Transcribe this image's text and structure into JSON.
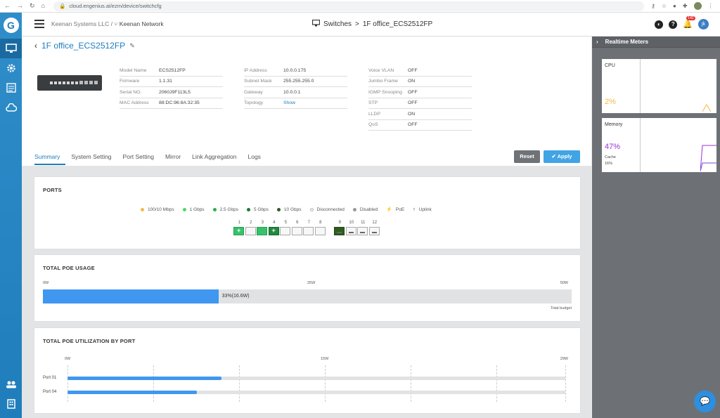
{
  "browser": {
    "url": "cloud.engenius.ai/ezm/device/switchcfg"
  },
  "header": {
    "org": "Keenan Systems LLC /",
    "network": "Keenan Network",
    "crumb_root": "Switches",
    "crumb_sep": ">",
    "crumb_leaf": "1F office_ECS2512FP",
    "notif_count": "142",
    "avatar_initials": "jk"
  },
  "device": {
    "title": "1F office_ECS2512FP",
    "col1": [
      {
        "k": "Model Name",
        "v": "ECS2512FP"
      },
      {
        "k": "Firmware",
        "v": "1.1.31"
      },
      {
        "k": "Serial NO.",
        "v": "2060J9F113L5"
      },
      {
        "k": "MAC Address",
        "v": "88:DC:96:8A:32:35"
      }
    ],
    "col2": [
      {
        "k": "IP Address",
        "v": "10.0.0.175"
      },
      {
        "k": "Subnet Mask",
        "v": "255.255.255.0"
      },
      {
        "k": "Gateway",
        "v": "10.0.0.1"
      },
      {
        "k": "Topology",
        "v": "Show"
      }
    ],
    "col3": [
      {
        "k": "Voice VLAN",
        "v": "OFF"
      },
      {
        "k": "Jumbo Frame",
        "v": "ON"
      },
      {
        "k": "IGMP Snooping",
        "v": "OFF"
      },
      {
        "k": "STP",
        "v": "OFF"
      },
      {
        "k": "LLDP",
        "v": "ON"
      },
      {
        "k": "QoS",
        "v": "OFF"
      }
    ]
  },
  "tabs": [
    "Summary",
    "System Setting",
    "Port Setting",
    "Mirror",
    "Link Aggregation",
    "Logs"
  ],
  "buttons": {
    "reset": "Reset",
    "apply": "Apply"
  },
  "ports_card": {
    "title": "PORTS",
    "legend": [
      {
        "label": "100/10 Mbps",
        "color": "#f5b942"
      },
      {
        "label": "1 Gbps",
        "color": "#4cd964"
      },
      {
        "label": "2.5 Gbps",
        "color": "#2ab04c"
      },
      {
        "label": "5 Gbps",
        "color": "#1a7a34"
      },
      {
        "label": "10 Gbps",
        "color": "#2e5d1d"
      },
      {
        "label": "Disconnected",
        "color": "#eeeeee"
      },
      {
        "label": "Disabled",
        "color": "#999999"
      },
      {
        "label": "PoE",
        "icon": "lightning-icon"
      },
      {
        "label": "Uplink",
        "icon": "arrow-up-icon"
      }
    ],
    "ports_rj45": [
      "1",
      "2",
      "3",
      "4",
      "5",
      "6",
      "7",
      "8"
    ],
    "ports_sfp": [
      "9",
      "10",
      "11",
      "12"
    ]
  },
  "poe_usage": {
    "title": "TOTAL POE USAGE",
    "axis": [
      "0W",
      "25W",
      "50W"
    ],
    "label": "33%(16.6W)",
    "fraction": 0.332,
    "budget_label": "Total budget"
  },
  "poe_by_port": {
    "title": "TOTAL POE UTILIZATION BY PORT",
    "axis": [
      "0W",
      "15W",
      "29W"
    ],
    "rows": [
      {
        "port": "Port 01",
        "fraction": 0.31
      },
      {
        "port": "Port 04",
        "fraction": 0.26
      }
    ]
  },
  "realtime": {
    "title": "Realtime Meters",
    "cpu_label": "CPU",
    "cpu_value": "2%",
    "mem_label": "Memory",
    "mem_value": "47%",
    "cache_label": "Cache",
    "cache_value": "16%"
  },
  "colors": {
    "accent": "#1f7dbc",
    "cpu": "#f5b942",
    "memory": "#9b30d9",
    "bar": "#3f97f0"
  }
}
